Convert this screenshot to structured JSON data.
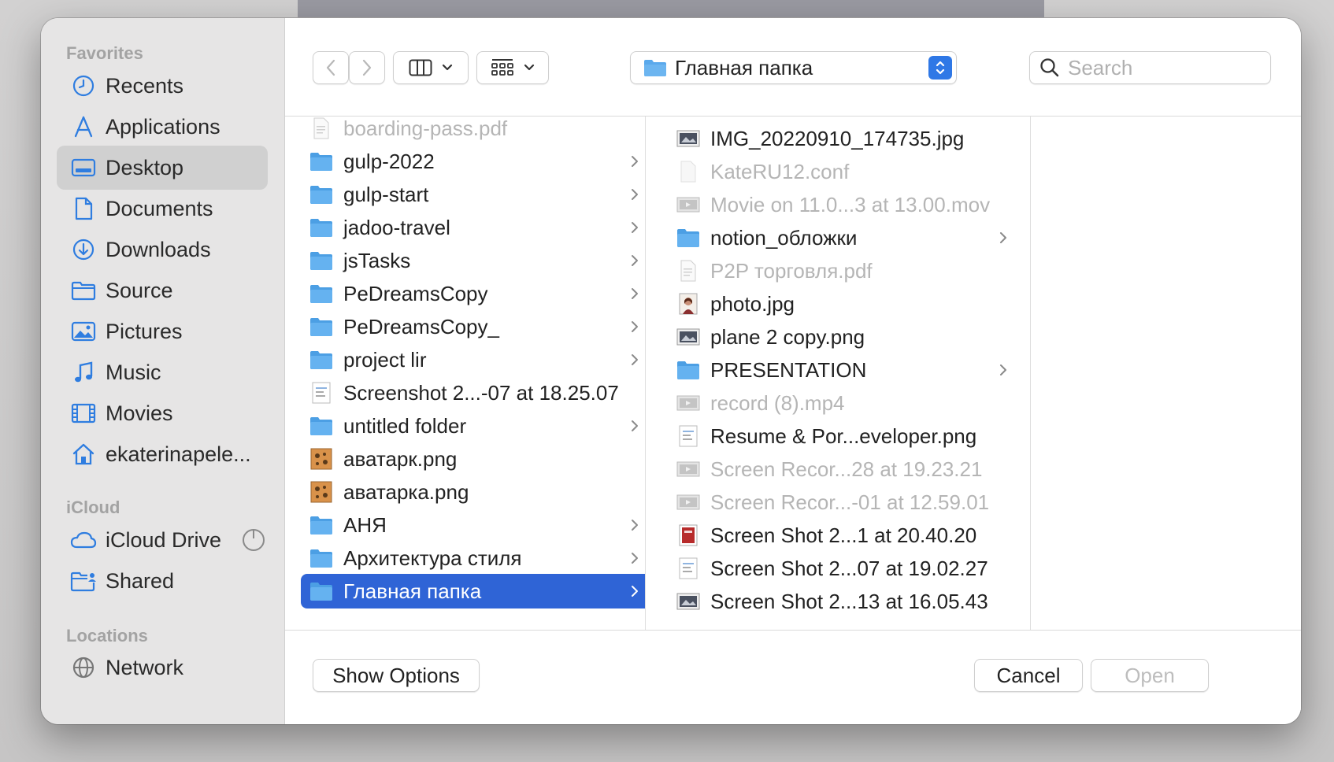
{
  "sidebar": {
    "favorites_title": "Favorites",
    "favorites": [
      {
        "label": "Recents",
        "icon": "clock-icon"
      },
      {
        "label": "Applications",
        "icon": "applications-icon"
      },
      {
        "label": "Desktop",
        "icon": "desktop-icon",
        "selected": true
      },
      {
        "label": "Documents",
        "icon": "document-icon"
      },
      {
        "label": "Downloads",
        "icon": "download-icon"
      },
      {
        "label": "Source",
        "icon": "folder-icon"
      },
      {
        "label": "Pictures",
        "icon": "pictures-icon"
      },
      {
        "label": "Music",
        "icon": "music-icon"
      },
      {
        "label": "Movies",
        "icon": "movies-icon"
      },
      {
        "label": "ekaterinapele...",
        "icon": "home-icon"
      }
    ],
    "icloud_title": "iCloud",
    "icloud": [
      {
        "label": "iCloud Drive",
        "icon": "cloud-icon"
      },
      {
        "label": "Shared",
        "icon": "shared-folder-icon"
      }
    ],
    "locations_title": "Locations",
    "locations": [
      {
        "label": "Network",
        "icon": "network-icon"
      }
    ]
  },
  "toolbar": {
    "back_icon": "chevron-left-icon",
    "forward_icon": "chevron-right-icon",
    "view_icon": "column-view-icon",
    "group_icon": "grid-icon",
    "path_label": "Главная папка",
    "search_placeholder": "Search"
  },
  "column1": [
    {
      "name": "boarding-pass.pdf",
      "type": "pdf",
      "dim": true,
      "folder": false
    },
    {
      "name": "gulp-2022",
      "type": "folder",
      "folder": true
    },
    {
      "name": "gulp-start",
      "type": "folder",
      "folder": true
    },
    {
      "name": "jadoo-travel",
      "type": "folder",
      "folder": true
    },
    {
      "name": "jsTasks",
      "type": "folder",
      "folder": true
    },
    {
      "name": "PeDreamsCopy",
      "type": "folder",
      "folder": true
    },
    {
      "name": "PeDreamsCopy_",
      "type": "folder",
      "folder": true
    },
    {
      "name": "project lir",
      "type": "folder",
      "folder": true
    },
    {
      "name": "Screenshot 2...-07 at 18.25.07",
      "type": "screenshot",
      "folder": false
    },
    {
      "name": "untitled folder",
      "type": "folder",
      "folder": true
    },
    {
      "name": "аватарк.png",
      "type": "image-orange",
      "folder": false
    },
    {
      "name": "аватарка.png",
      "type": "image-orange",
      "folder": false
    },
    {
      "name": "АНЯ",
      "type": "folder",
      "folder": true
    },
    {
      "name": "Архитектура стиля",
      "type": "folder",
      "folder": true
    },
    {
      "name": "Главная папка",
      "type": "folder",
      "folder": true,
      "selected": true
    }
  ],
  "column2": [
    {
      "name": "IMG_20220910_174735.jpg",
      "type": "image-dark",
      "folder": false
    },
    {
      "name": "KateRU12.conf",
      "type": "file-blank",
      "dim": true,
      "folder": false
    },
    {
      "name": "Movie on 11.0...3 at 13.00.mov",
      "type": "movie",
      "dim": true,
      "folder": false
    },
    {
      "name": "notion_обложки",
      "type": "folder",
      "folder": true
    },
    {
      "name": "P2P торговля.pdf",
      "type": "pdf",
      "dim": true,
      "folder": false
    },
    {
      "name": "photo.jpg",
      "type": "photo",
      "folder": false
    },
    {
      "name": "plane 2 copy.png",
      "type": "image-dark",
      "folder": false
    },
    {
      "name": "PRESENTATION",
      "type": "folder",
      "folder": true
    },
    {
      "name": "record (8).mp4",
      "type": "movie",
      "dim": true,
      "folder": false
    },
    {
      "name": "Resume & Por...eveloper.png",
      "type": "screenshot",
      "folder": false
    },
    {
      "name": "Screen Recor...28 at 19.23.21",
      "type": "movie",
      "dim": true,
      "folder": false
    },
    {
      "name": "Screen Recor...-01 at 12.59.01",
      "type": "movie",
      "dim": true,
      "folder": false
    },
    {
      "name": "Screen Shot 2...1 at 20.40.20",
      "type": "image-red",
      "folder": false
    },
    {
      "name": "Screen Shot 2...07 at 19.02.27",
      "type": "screenshot",
      "folder": false
    },
    {
      "name": "Screen Shot 2...13 at 16.05.43",
      "type": "image-dark",
      "folder": false
    }
  ],
  "footer": {
    "show_options": "Show Options",
    "cancel": "Cancel",
    "open": "Open"
  },
  "colors": {
    "accent": "#2f64d6",
    "folder": "#5aa9ec",
    "sidebar_icon": "#2f7de0",
    "dim_text": "#b5b5b5"
  }
}
